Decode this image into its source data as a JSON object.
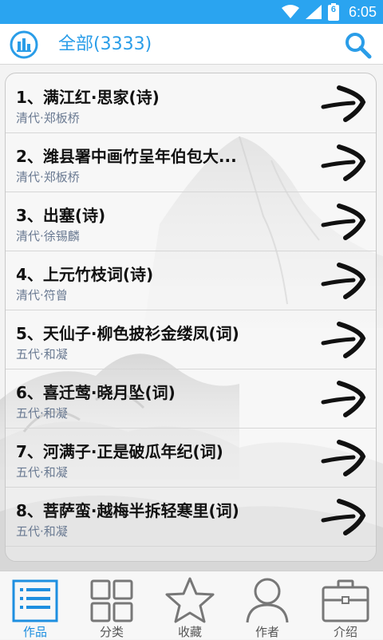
{
  "status_bar": {
    "time": "6:05",
    "battery_level": "6"
  },
  "header": {
    "title": "全部(3333)"
  },
  "poems": [
    {
      "title": "1、满江红·思家(诗)",
      "meta": "清代·郑板桥"
    },
    {
      "title": "2、潍县署中画竹呈年伯包大...",
      "meta": "清代·郑板桥"
    },
    {
      "title": "3、出塞(诗)",
      "meta": "清代·徐锡麟"
    },
    {
      "title": "4、上元竹枝词(诗)",
      "meta": "清代·符曾"
    },
    {
      "title": "5、天仙子·柳色披衫金缕凤(词)",
      "meta": "五代·和凝"
    },
    {
      "title": "6、喜迁莺·晓月坠(词)",
      "meta": "五代·和凝"
    },
    {
      "title": "7、河满子·正是破瓜年纪(词)",
      "meta": "五代·和凝"
    },
    {
      "title": "8、菩萨蛮·越梅半拆轻寒里(词)",
      "meta": "五代·和凝"
    }
  ],
  "bottom_nav": [
    {
      "label": "作品",
      "icon": "list-icon",
      "active": true
    },
    {
      "label": "分类",
      "icon": "grid-icon",
      "active": false
    },
    {
      "label": "收藏",
      "icon": "star-icon",
      "active": false
    },
    {
      "label": "作者",
      "icon": "person-icon",
      "active": false
    },
    {
      "label": "介绍",
      "icon": "briefcase-icon",
      "active": false
    }
  ],
  "colors": {
    "accent": "#2a9de8",
    "status_bar": "#2aa4f0",
    "meta_text": "#6a7a92"
  }
}
